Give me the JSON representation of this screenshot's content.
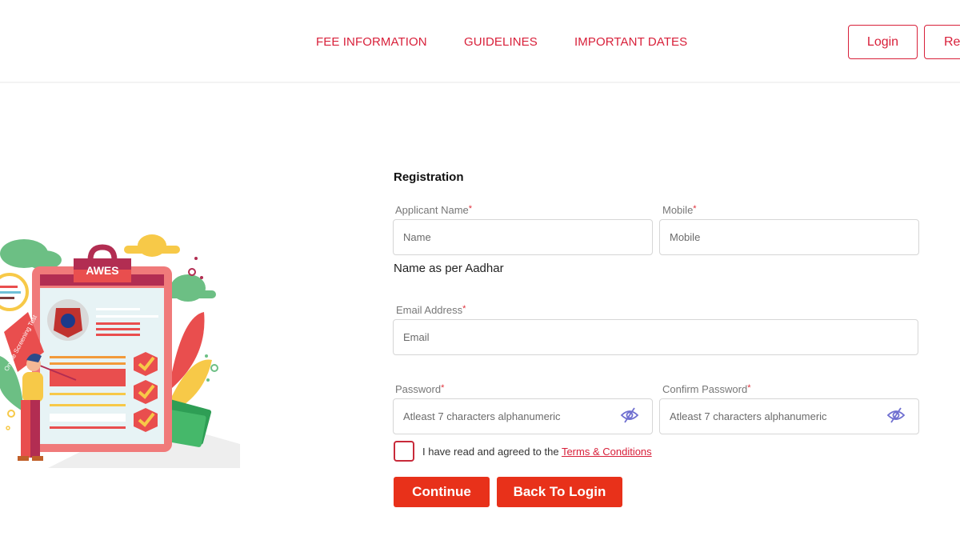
{
  "nav": {
    "links": [
      "FEE INFORMATION",
      "GUIDELINES",
      "IMPORTANT DATES"
    ],
    "login_label": "Login",
    "register_label": "Register"
  },
  "illustration": {
    "badge_text": "AWES",
    "flag_text": "Online Screening Test"
  },
  "form": {
    "title": "Registration",
    "applicant_name": {
      "label": "Applicant Name",
      "required": "*",
      "placeholder": "Name",
      "value": ""
    },
    "name_hint": "Name as per Aadhar",
    "mobile": {
      "label": "Mobile",
      "required": "*",
      "placeholder": "Mobile",
      "value": ""
    },
    "email": {
      "label": "Email Address",
      "required": "*",
      "placeholder": "Email",
      "value": ""
    },
    "password": {
      "label": "Password",
      "required": "*",
      "placeholder": "Atleast 7 characters alphanumeric",
      "value": "",
      "icon": "eye-slash-icon"
    },
    "confirm_password": {
      "label": "Confirm Password",
      "required": "*",
      "placeholder": "Atleast 7 characters alphanumeric",
      "value": "",
      "icon": "eye-slash-icon"
    },
    "terms_text": "I have read and agreed to the ",
    "terms_link": "Terms & Conditions",
    "terms_checked": false,
    "continue_label": "Continue",
    "back_label": "Back To Login"
  },
  "colors": {
    "brand_red": "#d8203a",
    "button_red": "#e8311a",
    "eye_icon": "#6f6fd0"
  }
}
